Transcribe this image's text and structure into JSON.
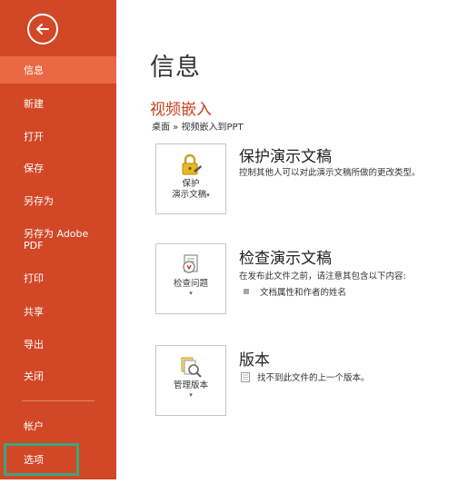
{
  "sidebar": {
    "items": [
      {
        "label": "信息"
      },
      {
        "label": "新建"
      },
      {
        "label": "打开"
      },
      {
        "label": "保存"
      },
      {
        "label": "另存为"
      },
      {
        "label": "另存为 Adobe PDF"
      },
      {
        "label": "打印"
      },
      {
        "label": "共享"
      },
      {
        "label": "导出"
      },
      {
        "label": "关闭"
      },
      {
        "label": "帐户"
      },
      {
        "label": "选项"
      }
    ],
    "active_index": 0,
    "bg_color": "#d24726",
    "active_color": "#ec6844",
    "highlight_color": "#3aa57c"
  },
  "main": {
    "title": "信息",
    "doc_name": "视频嵌入",
    "breadcrumb": "桌面 » 视频嵌入到PPT",
    "sections": {
      "protect": {
        "button_label_1": "保护",
        "button_label_2": "演示文稿",
        "dropdown_glyph": "▾",
        "title": "保护演示文稿",
        "description": "控制其他人可以对此演示文稿所做的更改类型。"
      },
      "inspect": {
        "button_label": "检查问题",
        "dropdown_glyph": "▾",
        "title": "检查演示文稿",
        "description": "在发布此文件之前，请注意其包含以下内容:",
        "bullets": [
          "文档属性和作者的姓名"
        ]
      },
      "versions": {
        "button_label": "管理版本",
        "dropdown_glyph": "▾",
        "title": "版本",
        "description": "找不到此文件的上一个版本。"
      }
    },
    "accent_color": "#c9401c"
  }
}
